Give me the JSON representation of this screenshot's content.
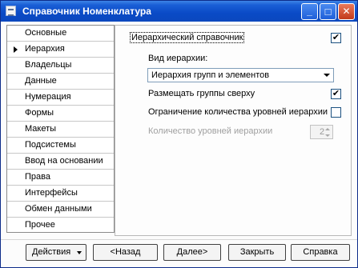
{
  "window": {
    "title": "Справочник Номенклатура",
    "controls": [
      "minimize-icon",
      "maximize-icon",
      "close-icon"
    ],
    "minimize_glyph": "_",
    "maximize_glyph": "□",
    "close_glyph": "✕"
  },
  "sidebar": {
    "selected": "Иерархия",
    "items": [
      {
        "label": "Основные"
      },
      {
        "label": "Иерархия"
      },
      {
        "label": "Владельцы"
      },
      {
        "label": "Данные"
      },
      {
        "label": "Нумерация"
      },
      {
        "label": "Формы"
      },
      {
        "label": "Макеты"
      },
      {
        "label": "Подсистемы"
      },
      {
        "label": "Ввод на основании"
      },
      {
        "label": "Права"
      },
      {
        "label": "Интерфейсы"
      },
      {
        "label": "Обмен данными"
      },
      {
        "label": "Прочее"
      }
    ]
  },
  "panel": {
    "hierarchical": {
      "label": "Иерархический справочник",
      "checked": true,
      "mark": "✔"
    },
    "hierarchy_type": {
      "label": "Вид иерархии:",
      "value": "Иерархия групп и элементов"
    },
    "groups_on_top": {
      "label": "Размещать группы сверху",
      "checked": true,
      "mark": "✔"
    },
    "limit_levels": {
      "label": "Ограничение количества уровней иерархии",
      "checked": false,
      "mark": ""
    },
    "level_count": {
      "label": "Количество уровней иерархии",
      "value": "2",
      "disabled": true
    }
  },
  "buttons": {
    "actions": "Действия",
    "back": "<Назад",
    "next": "Далее>",
    "close": "Закрыть",
    "help": "Справка"
  },
  "colors": {
    "titlebar": "#0a4ac6",
    "accent_border": "#1c5180"
  }
}
